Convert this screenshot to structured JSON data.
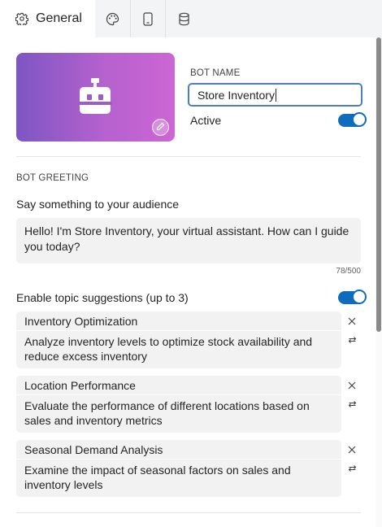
{
  "tabs": {
    "general_label": "General",
    "items": [
      {
        "icon": "gear-icon",
        "label": "General"
      },
      {
        "icon": "palette-icon"
      },
      {
        "icon": "tablet-icon"
      },
      {
        "icon": "database-icon"
      }
    ]
  },
  "bot": {
    "name_label": "BOT NAME",
    "name_value": "Store Inventory",
    "active_label": "Active",
    "active": true,
    "avatar_icon": "robot-icon",
    "edit_icon": "pencil-icon"
  },
  "greeting": {
    "section_label": "BOT GREETING",
    "prompt": "Say something to your audience",
    "value": "Hello! I'm Store Inventory, your virtual assistant. How can I guide you today?",
    "counter": "78/500"
  },
  "topics": {
    "toggle_label": "Enable topic suggestions (up to 3)",
    "enabled": true,
    "items": [
      {
        "title": "Inventory Optimization",
        "description": "Analyze inventory levels to optimize stock availability and reduce excess inventory"
      },
      {
        "title": "Location Performance",
        "description": "Evaluate the performance of different locations based on sales and inventory metrics"
      },
      {
        "title": "Seasonal Demand Analysis",
        "description": "Examine the impact of seasonal factors on sales and inventory levels"
      }
    ]
  },
  "colors": {
    "accent": "#0f6cbd",
    "focus_border": "#4a7fc4",
    "avatar_gradient_start": "#7d56c2",
    "avatar_gradient_end": "#cc66d4"
  }
}
